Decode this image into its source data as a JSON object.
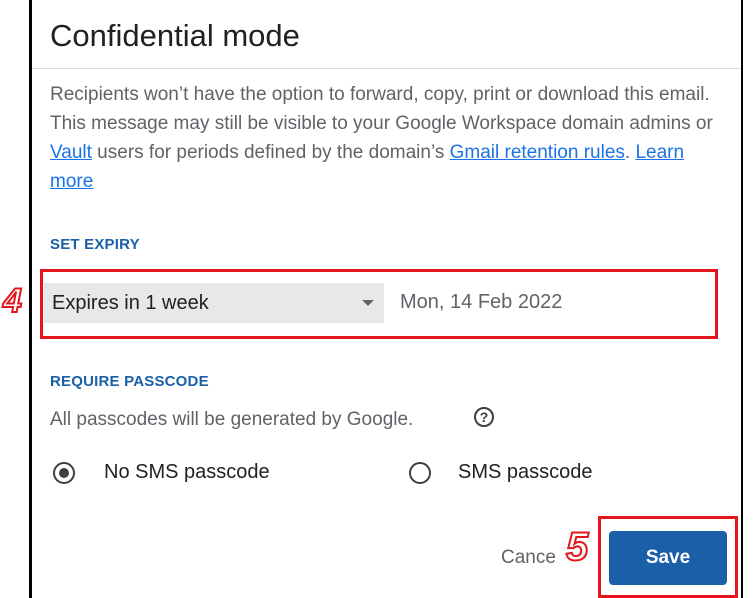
{
  "dialog": {
    "title": "Confidential mode",
    "description": {
      "text_1": "Recipients won’t have the option to forward, copy, print or download this email. This message may still be visible to your Google Workspace domain admins or ",
      "vault_link": "Vault",
      "text_2": " users for periods defined by the domain’s ",
      "retention_link": "Gmail retention rules",
      "text_3": ". ",
      "learn_more_link": "Learn more"
    },
    "expiry": {
      "section_label": "SET EXPIRY",
      "selected_option": "Expires in 1 week",
      "expiry_date": "Mon, 14 Feb 2022"
    },
    "passcode": {
      "section_label": "REQUIRE PASSCODE",
      "note": "All passcodes will be generated by Google.",
      "help_icon": "?",
      "options": [
        {
          "label": "No SMS passcode",
          "selected": true
        },
        {
          "label": "SMS passcode",
          "selected": false
        }
      ]
    },
    "actions": {
      "cancel_label": "Cance",
      "save_label": "Save"
    }
  },
  "annotations": {
    "step_4": "4",
    "step_5": "5",
    "highlight_color": "#e2161b"
  },
  "colors": {
    "accent": "#1a5fa8",
    "link": "#1a73e8",
    "dropdown_bg": "#e8e8e8"
  }
}
